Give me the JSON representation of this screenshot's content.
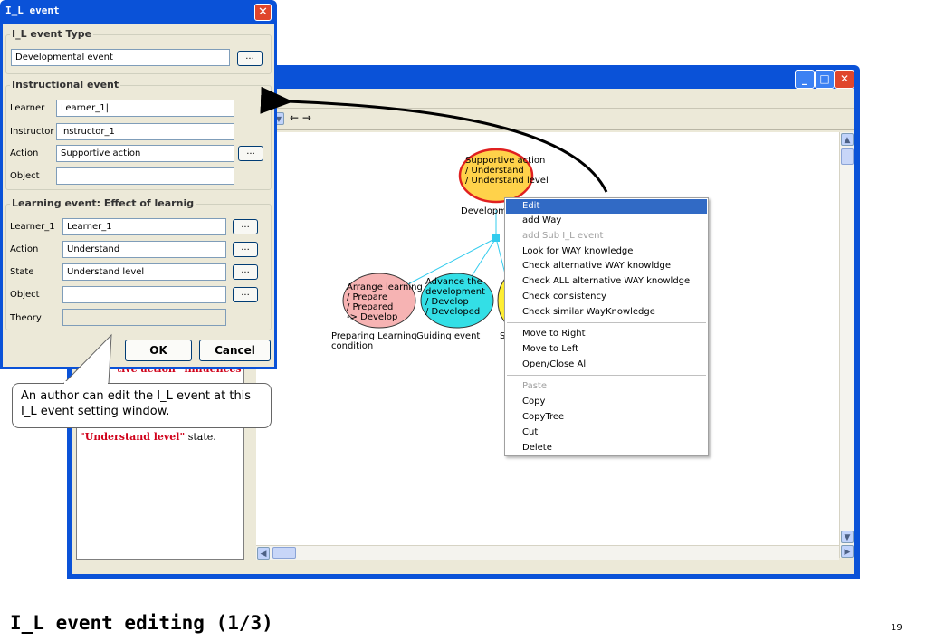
{
  "dialog": {
    "title": "I_L event",
    "type_group_label": "I_L event Type",
    "type_value": "Developmental event",
    "instructional_group_label": "Instructional event",
    "learner_label": "Learner",
    "learner_value": "Learner_1|",
    "instructor_label": "Instructor",
    "instructor_value": "Instructor_1",
    "action_label": "Action",
    "action_value": "Supportive action",
    "object_label": "Object",
    "object_value": "",
    "learning_group_label": "Learning event: Effect of learnig",
    "l_learner_label": "Learner_1",
    "l_learner_value": "Learner_1",
    "l_action_label": "Action",
    "l_action_value": "Understand",
    "l_state_label": "State",
    "l_state_value": "Understand level",
    "l_object_label": "Object",
    "l_object_value": "",
    "l_theory_label": "Theory",
    "ellipsis": "...",
    "ok_label": "OK",
    "cancel_label": "Cancel"
  },
  "toolbar": {
    "arrows": "← →"
  },
  "diagram": {
    "top_node": [
      "Supportive action",
      "/ Understand",
      "/ Understand level"
    ],
    "top_caption": "Developm",
    "node_left": [
      "Arrange learning",
      "/ Prepare",
      "/ Prepared",
      "-> Develop"
    ],
    "node_left_caption": [
      "Preparing Learning",
      "condition"
    ],
    "node_mid": [
      "Advance the",
      "development",
      "/ Develop",
      "/ Developed"
    ],
    "node_mid_caption": "Guiding event",
    "node_right_caption": "S"
  },
  "left_text": {
    "line1": "tive action\" influences",
    "line2_highlight": "\"Understand level\"",
    "line2_rest": " state."
  },
  "context_menu": [
    {
      "label": "Edit",
      "state": "selected"
    },
    {
      "label": "add Way",
      "state": "normal"
    },
    {
      "label": "add Sub I_L event",
      "state": "disabled"
    },
    {
      "label": "Look for WAY knowledge",
      "state": "normal"
    },
    {
      "label": "Check alternative WAY knowldge",
      "state": "normal"
    },
    {
      "label": "Check ALL alternative WAY knowldge",
      "state": "normal"
    },
    {
      "label": "Check consistency",
      "state": "normal"
    },
    {
      "label": "Check similar WayKnowledge",
      "state": "normal"
    },
    {
      "label": "Move to Right",
      "state": "normal"
    },
    {
      "label": "Move to Left",
      "state": "normal"
    },
    {
      "label": "Open/Close All",
      "state": "normal"
    },
    {
      "label": "Paste",
      "state": "disabled"
    },
    {
      "label": "Copy",
      "state": "normal"
    },
    {
      "label": "CopyTree",
      "state": "normal"
    },
    {
      "label": "Cut",
      "state": "normal"
    },
    {
      "label": "Delete",
      "state": "normal"
    }
  ],
  "callout": "An author can edit the I_L event at this I_L event setting window.",
  "slide": {
    "title": "I_L event editing (1/3)",
    "page": "19"
  },
  "colors": {
    "xp_blue": "#0a52d8",
    "menu_highlight": "#316ac5",
    "top_node_fill": "#ffd24a",
    "top_node_border": "#e02020",
    "left_node_fill": "#f6b3b3",
    "mid_node_fill": "#33dfe6",
    "connector": "#33ccee",
    "emphasis_text": "#d0021b"
  }
}
